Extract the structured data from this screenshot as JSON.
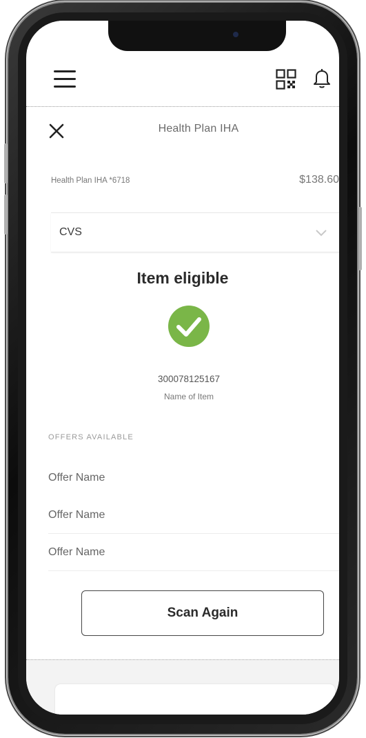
{
  "header": {
    "menu_icon": "hamburger-menu-icon",
    "qr_icon": "qr-code-icon",
    "bell_icon": "bell-icon"
  },
  "panel": {
    "close_icon": "close-icon",
    "title": "Health Plan IHA"
  },
  "account": {
    "name": "Health Plan IHA *6718",
    "balance": "$138.60"
  },
  "merchant_select": {
    "value": "CVS",
    "chevron_icon": "chevron-down-icon"
  },
  "result": {
    "status": "Item eligible",
    "status_icon": "check-circle-icon",
    "status_color": "#7ab648",
    "item_id": "300078125167",
    "item_name": "Name of Item"
  },
  "offers": {
    "heading": "OFFERS AVAILABLE",
    "items": [
      {
        "name": "Offer Name"
      },
      {
        "name": "Offer Name"
      },
      {
        "name": "Offer Name"
      }
    ]
  },
  "actions": {
    "scan_again_label": "Scan Again"
  }
}
